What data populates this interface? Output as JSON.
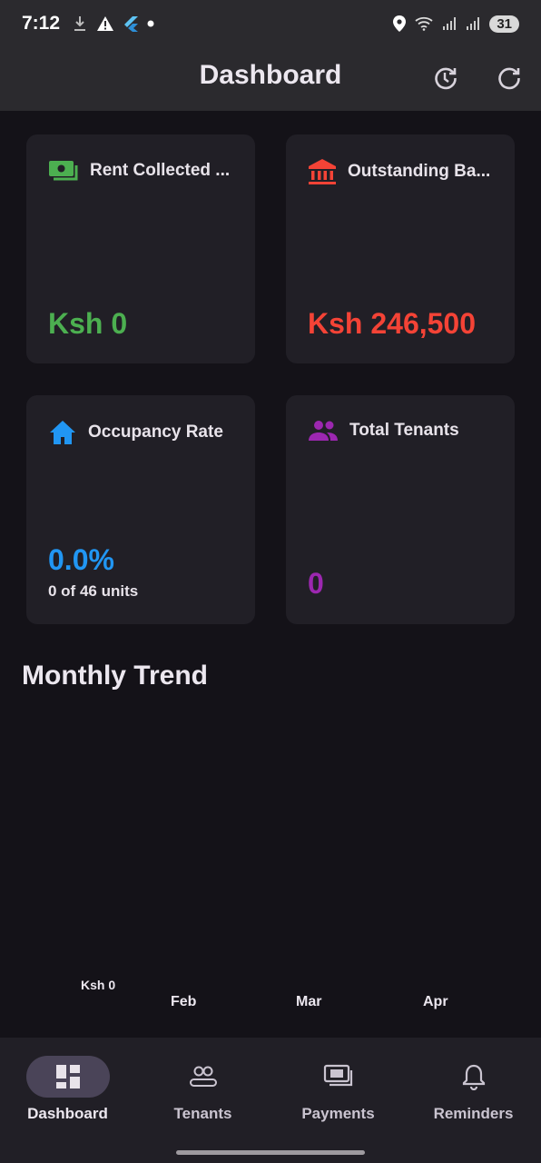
{
  "status_bar": {
    "time": "7:12",
    "battery": "31"
  },
  "app_bar": {
    "title": "Dashboard",
    "actions": [
      "history-icon",
      "refresh-icon"
    ]
  },
  "cards": [
    {
      "title": "Rent Collected ...",
      "value": "Ksh 0",
      "icon": "money-icon",
      "accent": "#4caf50"
    },
    {
      "title": "Outstanding Ba...",
      "value": "Ksh 246,500",
      "icon": "bank-icon",
      "accent": "#f44336"
    },
    {
      "title": "Occupancy Rate",
      "value": "0.0%",
      "subtitle": "0 of 46 units",
      "icon": "home-icon",
      "accent": "#2196f3"
    },
    {
      "title": "Total Tenants",
      "value": "0",
      "icon": "people-icon",
      "accent": "#9c27b0"
    }
  ],
  "trend": {
    "title": "Monthly Trend",
    "chart_data": {
      "type": "bar",
      "categories": [
        "Feb",
        "Mar",
        "Apr"
      ],
      "values": [
        0,
        0,
        0
      ],
      "y_tick_labels": [
        "Ksh 0"
      ],
      "xlabel": "",
      "ylabel": ""
    }
  },
  "bottom_nav": {
    "items": [
      {
        "label": "Dashboard",
        "icon": "dashboard-icon",
        "active": true
      },
      {
        "label": "Tenants",
        "icon": "tenants-icon",
        "active": false
      },
      {
        "label": "Payments",
        "icon": "payments-icon",
        "active": false
      },
      {
        "label": "Reminders",
        "icon": "bell-icon",
        "active": false
      }
    ]
  }
}
